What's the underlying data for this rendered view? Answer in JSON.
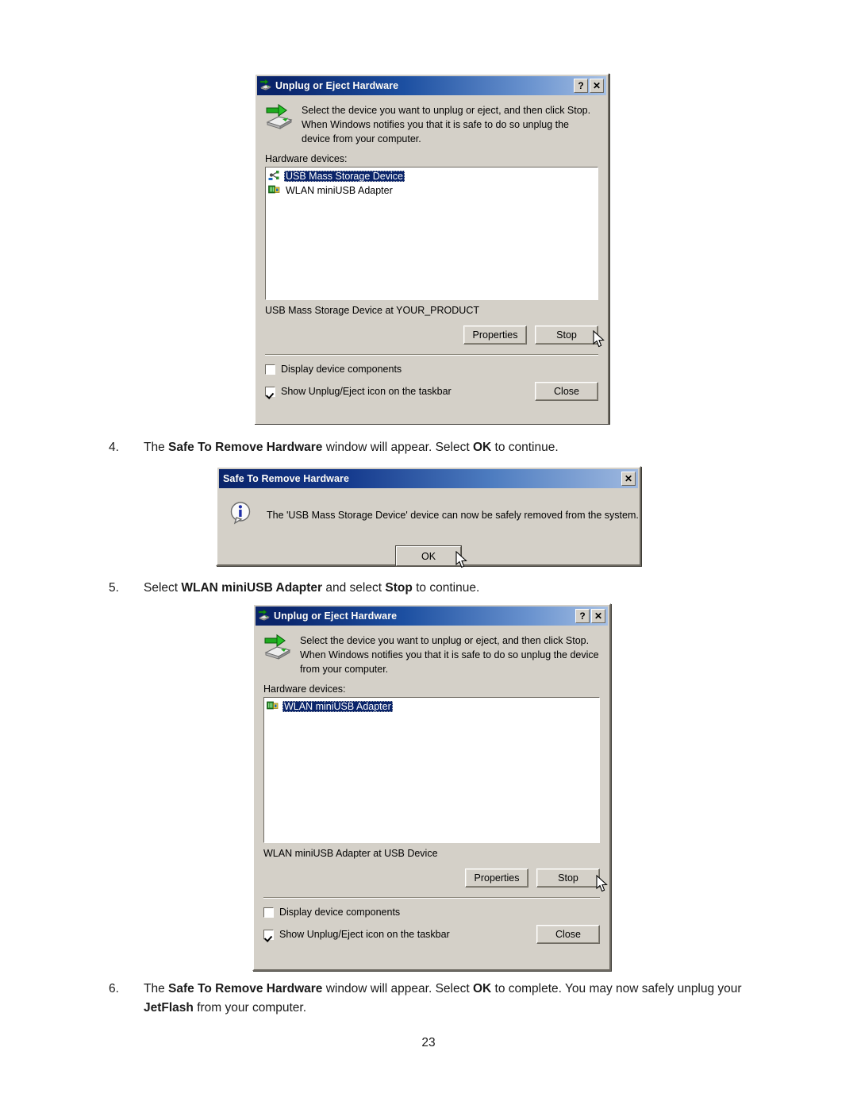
{
  "page": {
    "number": "23",
    "background": "#ffffff"
  },
  "colors": {
    "titlebar_dark": "#0a246a",
    "titlebar_light": "#a6c0e4",
    "dialog_face": "#d4d0c8",
    "selection": "#0a246a",
    "text": "#000000"
  },
  "steps": [
    {
      "number": "4.",
      "segments": [
        {
          "text": "The ",
          "bold": false
        },
        {
          "text": "Safe To Remove Hardware",
          "bold": true
        },
        {
          "text": " window will appear.   Select ",
          "bold": false
        },
        {
          "text": "OK",
          "bold": true
        },
        {
          "text": " to continue.",
          "bold": false
        }
      ]
    },
    {
      "number": "5.",
      "segments": [
        {
          "text": "Select ",
          "bold": false
        },
        {
          "text": "WLAN miniUSB Adapter",
          "bold": true
        },
        {
          "text": " and select ",
          "bold": false
        },
        {
          "text": "Stop",
          "bold": true
        },
        {
          "text": " to continue.",
          "bold": false
        }
      ]
    },
    {
      "number": "6.",
      "segments": [
        {
          "text": "The ",
          "bold": false
        },
        {
          "text": "Safe To Remove Hardware",
          "bold": true
        },
        {
          "text": " window will appear. Select ",
          "bold": false
        },
        {
          "text": "OK",
          "bold": true
        },
        {
          "text": " to complete.   You may now safely unplug your ",
          "bold": false
        },
        {
          "text": "JetFlash",
          "bold": true
        },
        {
          "text": " from your computer.",
          "bold": false
        }
      ]
    }
  ],
  "dialog_unplug_1": {
    "title": "Unplug or Eject Hardware",
    "title_icon": "unplug-hardware-icon",
    "titlebar_buttons": [
      {
        "name": "help-button",
        "glyph": "?"
      },
      {
        "name": "close-button",
        "glyph": "✕"
      }
    ],
    "instruction": "Select the device you want to unplug or eject, and then click Stop. When Windows notifies you that it is safe to do so unplug the device from your computer.",
    "devices_label": "Hardware devices:",
    "devices": [
      {
        "label": "USB Mass Storage Device",
        "icon": "usb-device-icon",
        "selected": true
      },
      {
        "label": "WLAN miniUSB Adapter",
        "icon": "network-adapter-icon",
        "selected": false
      }
    ],
    "status": "USB Mass Storage Device at YOUR_PRODUCT",
    "buttons": {
      "properties": "Properties",
      "stop": "Stop",
      "close": "Close"
    },
    "checkboxes": [
      {
        "label": "Display device components",
        "checked": false
      },
      {
        "label": "Show Unplug/Eject icon on the taskbar",
        "checked": true
      }
    ]
  },
  "dialog_safe_to_remove": {
    "title": "Safe To Remove Hardware",
    "titlebar_buttons": [
      {
        "name": "close-button",
        "glyph": "✕"
      }
    ],
    "icon": "info-icon",
    "message": "The 'USB Mass Storage Device' device can now be safely removed from the system.",
    "ok_label": "OK"
  },
  "dialog_unplug_2": {
    "title": "Unplug or Eject Hardware",
    "title_icon": "unplug-hardware-icon",
    "titlebar_buttons": [
      {
        "name": "help-button",
        "glyph": "?"
      },
      {
        "name": "close-button",
        "glyph": "✕"
      }
    ],
    "instruction": "Select the device you want to unplug or eject, and then click Stop. When Windows notifies you that it is safe to do so unplug the device from your computer.",
    "devices_label": "Hardware devices:",
    "devices": [
      {
        "label": "WLAN miniUSB Adapter",
        "icon": "network-adapter-icon",
        "selected": true
      }
    ],
    "status": "WLAN miniUSB Adapter at USB Device",
    "buttons": {
      "properties": "Properties",
      "stop": "Stop",
      "close": "Close"
    },
    "checkboxes": [
      {
        "label": "Display device components",
        "checked": false
      },
      {
        "label": "Show Unplug/Eject icon on the taskbar",
        "checked": true
      }
    ]
  }
}
